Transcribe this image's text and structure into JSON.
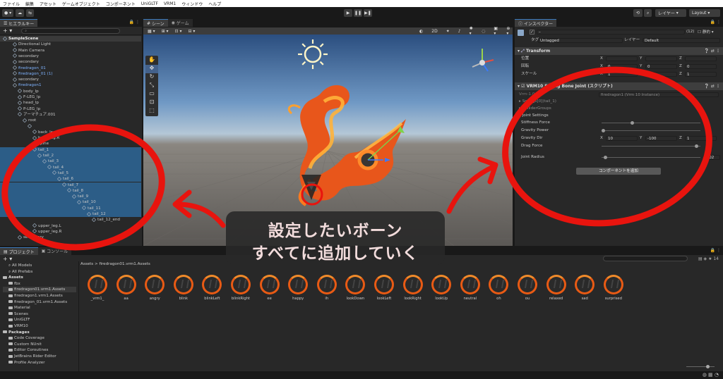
{
  "menubar": [
    "ファイル",
    "編集",
    "アセット",
    "ゲームオブジェクト",
    "コンポーネント",
    "UniGLTF",
    "VRM1",
    "ウィンドウ",
    "ヘルプ"
  ],
  "toolbar": {
    "layers_label": "レイヤー",
    "layout_label": "Layout"
  },
  "hierarchy": {
    "tab": "ヒエラルキー",
    "rows": [
      {
        "label": "SampleScene",
        "indent": 0,
        "kind": "scene"
      },
      {
        "label": "Directional Light",
        "indent": 2,
        "kind": "go"
      },
      {
        "label": "Main Camera",
        "indent": 2,
        "kind": "go"
      },
      {
        "label": "secondary",
        "indent": 2,
        "kind": "go"
      },
      {
        "label": "secondary",
        "indent": 2,
        "kind": "go"
      },
      {
        "label": "firedragon_01",
        "indent": 2,
        "kind": "prefab"
      },
      {
        "label": "firedragon_01 (1)",
        "indent": 2,
        "kind": "prefab"
      },
      {
        "label": "secondary",
        "indent": 2,
        "kind": "go"
      },
      {
        "label": "firedragon1",
        "indent": 2,
        "kind": "prefab"
      },
      {
        "label": "body_lp",
        "indent": 3,
        "kind": "go"
      },
      {
        "label": "F-LEG_lp",
        "indent": 3,
        "kind": "go"
      },
      {
        "label": "head_lp",
        "indent": 3,
        "kind": "go"
      },
      {
        "label": "P-LEG_lp",
        "indent": 3,
        "kind": "go"
      },
      {
        "label": "アーマチュア.001",
        "indent": 3,
        "kind": "go"
      },
      {
        "label": "root",
        "indent": 4,
        "kind": "go"
      },
      {
        "label": "",
        "indent": 5,
        "kind": "go"
      },
      {
        "label": "back_leg.L",
        "indent": 6,
        "kind": "go"
      },
      {
        "label": "back_leg.R",
        "indent": 6,
        "kind": "go"
      },
      {
        "label": "spine",
        "indent": 6,
        "kind": "go"
      },
      {
        "label": "tail_1",
        "indent": 6,
        "kind": "sel"
      },
      {
        "label": "tail_2",
        "indent": 7,
        "kind": "sel"
      },
      {
        "label": "tail_3",
        "indent": 8,
        "kind": "sel"
      },
      {
        "label": "tail_4",
        "indent": 9,
        "kind": "sel"
      },
      {
        "label": "tail_5",
        "indent": 10,
        "kind": "sel"
      },
      {
        "label": "tail_6",
        "indent": 11,
        "kind": "sel"
      },
      {
        "label": "tail_7",
        "indent": 12,
        "kind": "sel"
      },
      {
        "label": "tail_8",
        "indent": 13,
        "kind": "sel"
      },
      {
        "label": "tail_9",
        "indent": 14,
        "kind": "sel"
      },
      {
        "label": "tail_10",
        "indent": 15,
        "kind": "sel"
      },
      {
        "label": "tail_11",
        "indent": 16,
        "kind": "sel"
      },
      {
        "label": "tail_12",
        "indent": 17,
        "kind": "sel"
      },
      {
        "label": "tail_12_end",
        "indent": 18,
        "kind": "go"
      },
      {
        "label": "upper_leg.L",
        "indent": 6,
        "kind": "go"
      },
      {
        "label": "upper_leg.R",
        "indent": 6,
        "kind": "go"
      },
      {
        "label": "secondary",
        "indent": 3,
        "kind": "go"
      }
    ]
  },
  "scene": {
    "tab_scene": "シーン",
    "tab_game": "ゲーム",
    "mode_2d": "2D"
  },
  "inspector": {
    "tab": "インスペクター",
    "count": "(12)",
    "static_label": "静的",
    "tag_label": "タグ",
    "tag_value": "Untagged",
    "layer_label": "レイヤー",
    "layer_value": "Default",
    "transform": {
      "title": "Transform",
      "rows": [
        {
          "label": "位置",
          "x": "",
          "y": "",
          "z": ""
        },
        {
          "label": "回転",
          "x": "0",
          "y": "0",
          "z": "0"
        },
        {
          "label": "スケール",
          "x": "1",
          "y": "1",
          "z": "1"
        }
      ]
    },
    "spring": {
      "title": "VRM10 Spring Bone Joint (スクリプト)",
      "vrm_label": "Vrm-1.0",
      "vrm_value": "firedragon1 (Vrm 10 Instance)",
      "springs": "Springs[0](tail_1)",
      "collider_groups": "ColliderGroups",
      "joint_settings": "Joint Settings",
      "stiffness": "Stiffness Force",
      "gravity_power": "Gravity Power",
      "gravity_dir": "Gravity Dir",
      "gravity_dir_x": "10",
      "gravity_dir_y": "-100",
      "gravity_dir_z": "1",
      "drag_force": "Drag Force",
      "joint_radius": "Joint Radius",
      "joint_radius_value": "0.02",
      "stiffness_level": 0.3,
      "gravity_power_level": 0.0,
      "drag_level": 0.98,
      "radius_level": 0.02
    },
    "add_component": "コンポーネントを追加"
  },
  "project": {
    "tab_project": "プロジェクト",
    "tab_console": "コンソール",
    "tree": [
      {
        "label": "All Models",
        "indent": 1,
        "kind": "search"
      },
      {
        "label": "All Prefabs",
        "indent": 1,
        "kind": "search"
      },
      {
        "label": "Assets",
        "indent": 0,
        "kind": "header"
      },
      {
        "label": "fbx",
        "indent": 1,
        "kind": "folder"
      },
      {
        "label": "firedragon01.vrm1.Assets",
        "indent": 1,
        "kind": "selected"
      },
      {
        "label": "firedragon1.vrm1.Assets",
        "indent": 1,
        "kind": "folder"
      },
      {
        "label": "firedragon_01.vrm1.Assets",
        "indent": 1,
        "kind": "folder"
      },
      {
        "label": "Material",
        "indent": 1,
        "kind": "folder"
      },
      {
        "label": "Scenes",
        "indent": 1,
        "kind": "folder"
      },
      {
        "label": "UniGLTF",
        "indent": 1,
        "kind": "folder"
      },
      {
        "label": "VRM10",
        "indent": 1,
        "kind": "folder"
      },
      {
        "label": "Packages",
        "indent": 0,
        "kind": "header"
      },
      {
        "label": "Code Coverage",
        "indent": 1,
        "kind": "folder"
      },
      {
        "label": "Custom NUnit",
        "indent": 1,
        "kind": "folder"
      },
      {
        "label": "Editor Coroutines",
        "indent": 1,
        "kind": "folder"
      },
      {
        "label": "JetBrains Rider Editor",
        "indent": 1,
        "kind": "folder"
      },
      {
        "label": "Profile Analyzer",
        "indent": 1,
        "kind": "folder"
      }
    ],
    "breadcrumb": "Assets > firedragon01.vrm1.Assets",
    "assets": [
      "_vrm1_",
      "aa",
      "angry",
      "blink",
      "blinkLeft",
      "blinkRight",
      "ee",
      "happy",
      "ih",
      "lookDown",
      "lookLeft",
      "lookRight",
      "lookUp",
      "neutral",
      "oh",
      "ou",
      "relaxed",
      "sad",
      "surprised"
    ],
    "count_label": "14"
  },
  "caption": {
    "line1": "設定したいボーン",
    "line2": "すべてに追加していく"
  },
  "colors": {
    "highlight": "#e8140e",
    "selection": "#2c5d87",
    "accent": "#3a79bb"
  }
}
